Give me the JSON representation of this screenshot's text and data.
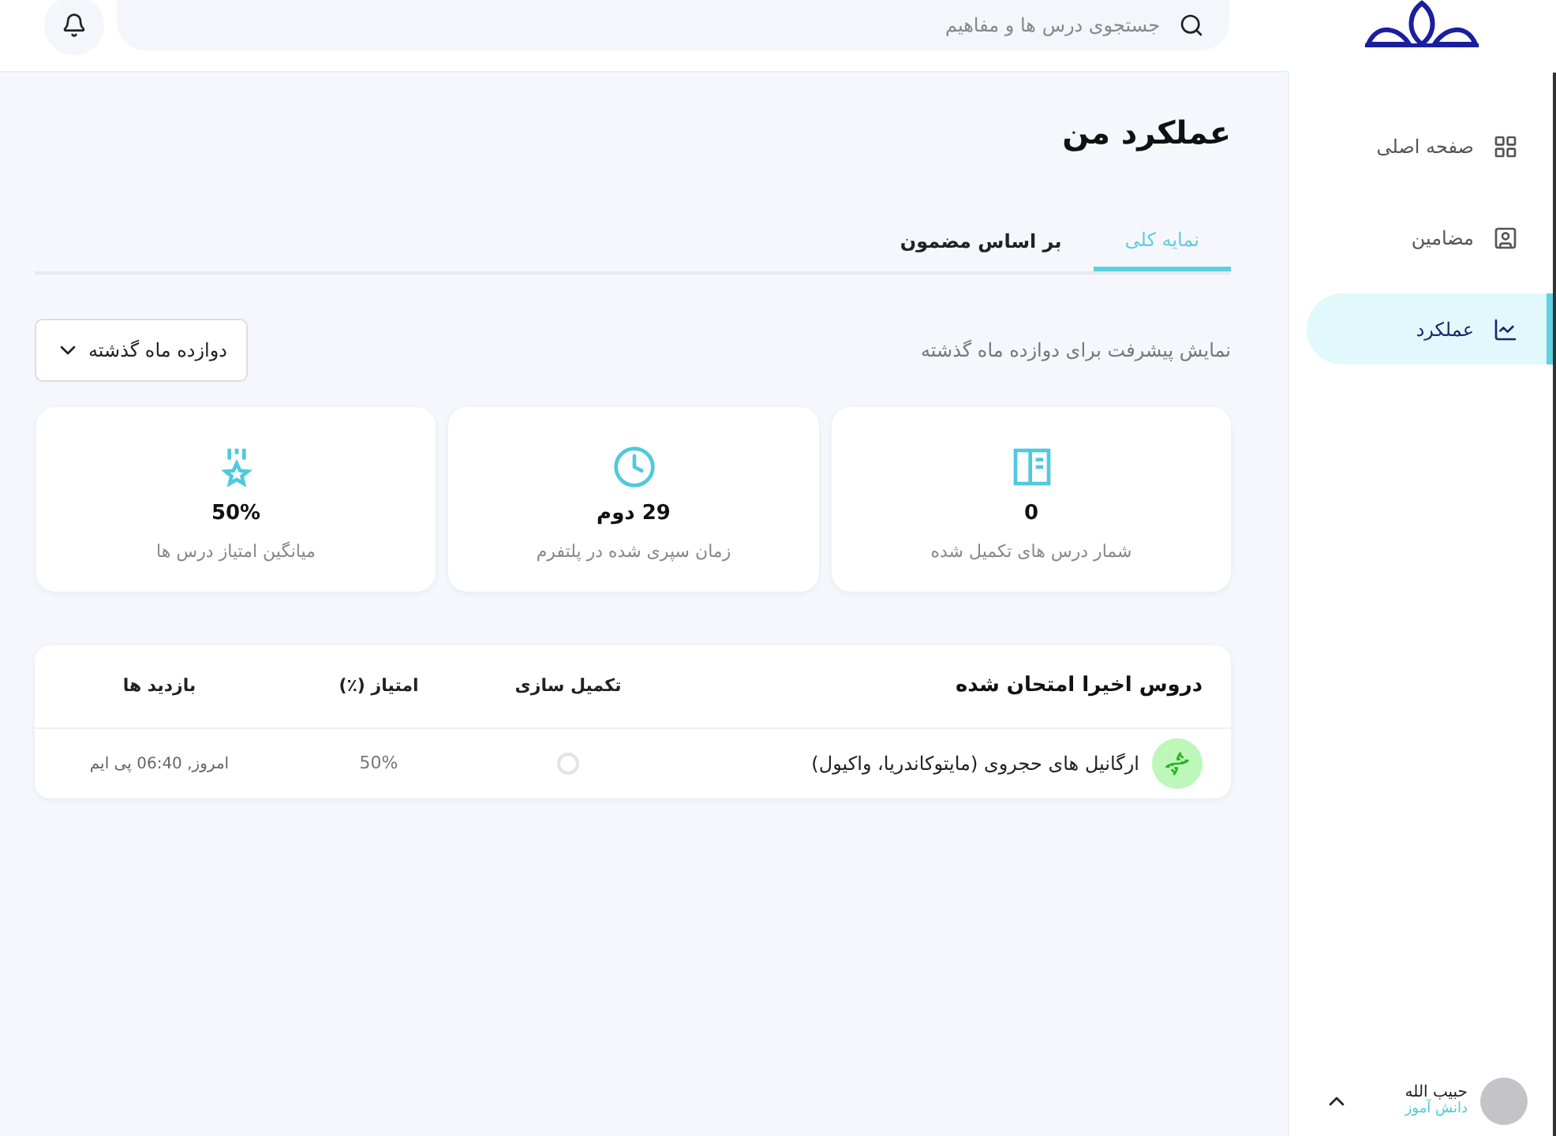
{
  "header": {
    "search": {
      "placeholder": "جستجوی درس ها و مفاهیم"
    }
  },
  "sidebar": {
    "items": [
      {
        "label": "صفحه اصلی",
        "kind": "home",
        "selected": false
      },
      {
        "label": "مضامین",
        "kind": "subjects",
        "selected": false
      },
      {
        "label": "عملکرد",
        "kind": "performance",
        "selected": true
      }
    ],
    "user": {
      "name": "حبیب الله",
      "role": "دانش آموز"
    }
  },
  "page": {
    "title": "عملکرد من",
    "tabs": [
      {
        "label": "نمایه کلی",
        "selected": true
      },
      {
        "label": "بر اساس مضمون",
        "selected": false
      }
    ],
    "range_note": "نمایش پیشرفت برای دوازده ماه گذشته",
    "range_select": {
      "value": "دوازده ماه گذشته"
    },
    "stats": [
      {
        "kind": "lessons",
        "value": "0",
        "label": "شمار درس های تکمیل شده"
      },
      {
        "kind": "time",
        "value": "29 دوم",
        "label": "زمان سپری شده در پلتفرم"
      },
      {
        "kind": "score",
        "value": "50%",
        "label": "میانگین امتیاز درس ها"
      }
    ],
    "table": {
      "title": "دروس اخیرا امتحان شده",
      "columns": [
        "تکمیل سازی",
        "امتیاز (٪)",
        "بازدید ها"
      ],
      "rows": [
        {
          "name": "ارگانیل های حجروی (مایتوکاندریا، واکیول)",
          "completed": false,
          "score": "50%",
          "visited": "امروز, 06:40 پی ایم"
        }
      ]
    }
  }
}
